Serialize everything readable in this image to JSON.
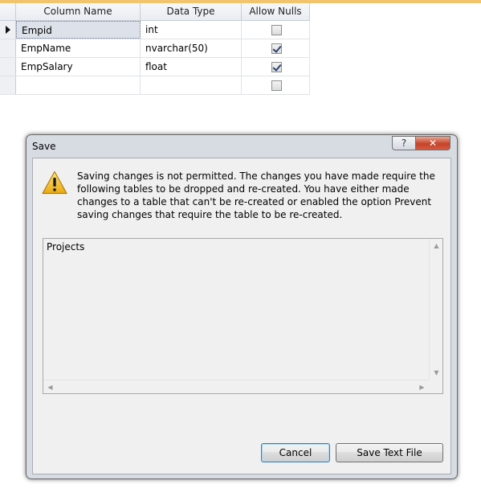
{
  "grid": {
    "headers": [
      "Column Name",
      "Data Type",
      "Allow Nulls"
    ],
    "rows": [
      {
        "name": "Empid",
        "type": "int",
        "allow_nulls": false
      },
      {
        "name": "EmpName",
        "type": "nvarchar(50)",
        "allow_nulls": true
      },
      {
        "name": "EmpSalary",
        "type": "float",
        "allow_nulls": true
      },
      {
        "name": "",
        "type": "",
        "allow_nulls": false
      }
    ]
  },
  "dialog": {
    "title": "Save",
    "help_label": "?",
    "close_label": "✕",
    "message": "Saving changes is not permitted. The changes you have made require the following tables to be dropped and re-created. You have either made changes to a table that can't be re-created or enabled the option Prevent saving changes that require the table to be re-created.",
    "list_items": [
      "Projects"
    ],
    "cancel_label": "Cancel",
    "save_text_label": "Save Text File",
    "icon": "warning-icon"
  },
  "colors": {
    "accent_top": "#f2c46e",
    "close_red": "#c7432a",
    "warning_yellow": "#f3c623"
  }
}
